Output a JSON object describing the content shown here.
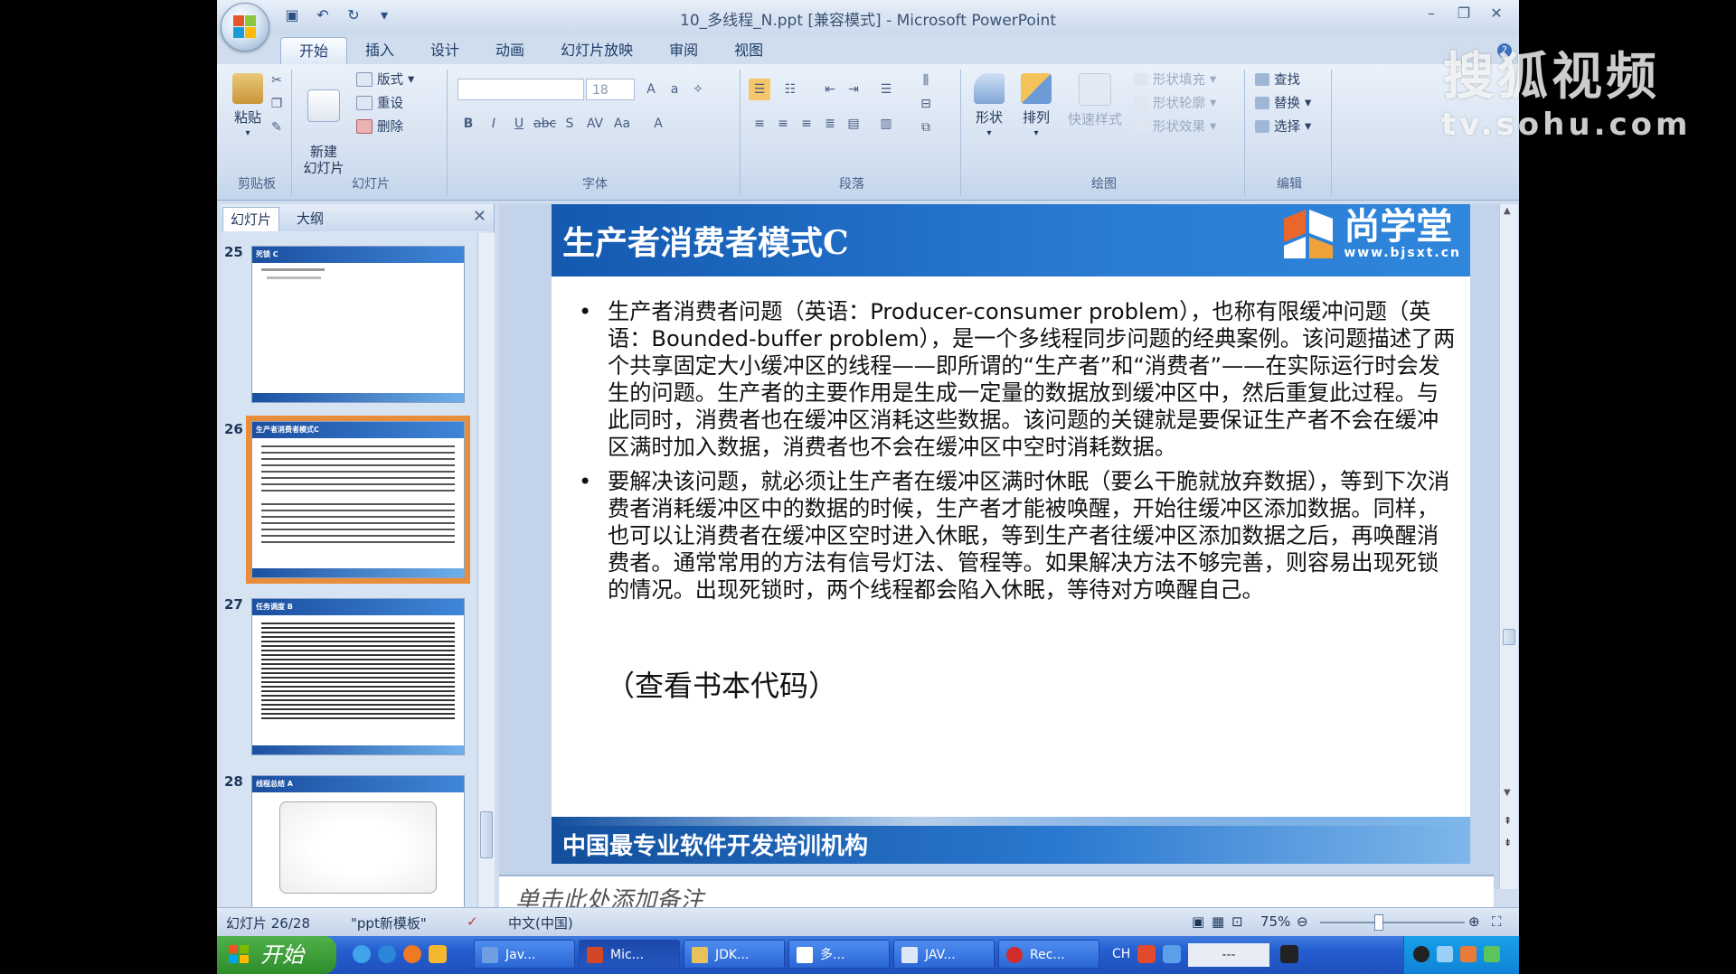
{
  "window": {
    "title": "10_多线程_N.ppt [兼容模式] - Microsoft PowerPoint"
  },
  "ribbon": {
    "tabs": [
      "开始",
      "插入",
      "设计",
      "动画",
      "幻灯片放映",
      "审阅",
      "视图"
    ],
    "clipboard": {
      "paste": "粘贴",
      "label": "剪贴板"
    },
    "slides": {
      "new_slide": "新建\n幻灯片",
      "layout": "版式",
      "reset": "重设",
      "delete": "删除",
      "label": "幻灯片"
    },
    "font": {
      "font_name": "",
      "font_size": "18",
      "label": "字体"
    },
    "paragraph": {
      "label": "段落"
    },
    "drawing": {
      "shape": "形状",
      "arrange": "排列",
      "quick_styles": "快速样式",
      "shape_fill": "形状填充",
      "shape_outline": "形状轮廓",
      "shape_effects": "形状效果",
      "label": "绘图"
    },
    "editing": {
      "find": "查找",
      "replace": "替换",
      "select": "选择",
      "label": "编辑"
    }
  },
  "pane": {
    "tabs": [
      "幻灯片",
      "大纲"
    ],
    "thumbnails": [
      {
        "number": "25",
        "title": "死锁 C",
        "selected": false
      },
      {
        "number": "26",
        "title": "生产者消费者模式C",
        "selected": true
      },
      {
        "number": "27",
        "title": "任务调度 B",
        "selected": false
      },
      {
        "number": "28",
        "title": "线程总结 A",
        "selected": false
      }
    ]
  },
  "slide": {
    "title": "生产者消费者模式C",
    "logo_name": "尚学堂",
    "logo_url": "www.bjsxt.cn",
    "bullets": [
      "生产者消费者问题（英语：Producer-consumer problem），也称有限缓冲问题（英语：Bounded-buffer problem），是一个多线程同步问题的经典案例。该问题描述了两个共享固定大小缓冲区的线程——即所谓的“生产者”和“消费者”——在实际运行时会发生的问题。生产者的主要作用是生成一定量的数据放到缓冲区中，然后重复此过程。与此同时，消费者也在缓冲区消耗这些数据。该问题的关键就是要保证生产者不会在缓冲区满时加入数据，消费者也不会在缓冲区中空时消耗数据。",
      "要解决该问题，就必须让生产者在缓冲区满时休眠（要么干脆就放弃数据），等到下次消费者消耗缓冲区中的数据的时候，生产者才能被唤醒，开始往缓冲区添加数据。同样，也可以让消费者在缓冲区空时进入休眠，等到生产者往缓冲区添加数据之后，再唤醒消费者。通常常用的方法有信号灯法、管程等。如果解决方法不够完善，则容易出现死锁的情况。出现死锁时，两个线程都会陷入休眠，等待对方唤醒自己。"
    ],
    "cta": "（查看书本代码）",
    "footer": "中国最专业软件开发培训机构"
  },
  "notes": {
    "placeholder": "单击此处添加备注"
  },
  "status": {
    "slide_count": "幻灯片 26/28",
    "theme": "\"ppt新模板\"",
    "language": "中文(中国)",
    "zoom": "75%"
  },
  "taskbar": {
    "start": "开始",
    "buttons": [
      "Jav...",
      "Mic...",
      "JDK...",
      "多...",
      "JAV...",
      "Rec..."
    ],
    "ime": "CH",
    "tray_text": "---"
  },
  "watermark": {
    "name": "搜狐视频",
    "url": "tv.sohu.com"
  },
  "colors": {
    "slide_blue": "#1f66c1",
    "selection_orange": "#e78d3b",
    "ribbon_bg": "#d3e0f0"
  }
}
